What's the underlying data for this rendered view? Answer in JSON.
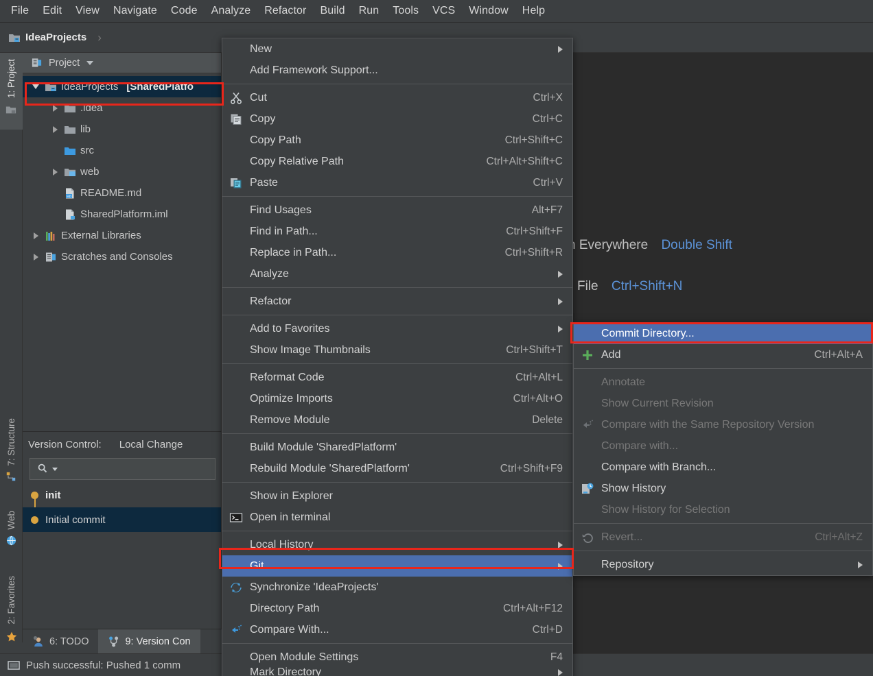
{
  "menubar": {
    "items": [
      {
        "label": "File",
        "mnemonic": "F"
      },
      {
        "label": "Edit",
        "mnemonic": "E"
      },
      {
        "label": "View",
        "mnemonic": "V"
      },
      {
        "label": "Navigate",
        "mnemonic": "N"
      },
      {
        "label": "Code",
        "mnemonic": "C"
      },
      {
        "label": "Analyze",
        "mnemonic": "y"
      },
      {
        "label": "Refactor",
        "mnemonic": "R"
      },
      {
        "label": "Build",
        "mnemonic": "B"
      },
      {
        "label": "Run",
        "mnemonic": "u"
      },
      {
        "label": "Tools",
        "mnemonic": "T"
      },
      {
        "label": "VCS",
        "mnemonic": "S"
      },
      {
        "label": "Window",
        "mnemonic": "W"
      },
      {
        "label": "Help",
        "mnemonic": "H"
      }
    ]
  },
  "navbar": {
    "project_name": "IdeaProjects",
    "separator": "›"
  },
  "toolstrip": {
    "left_top": [
      {
        "label": "1: Project",
        "icon": "project-icon",
        "active": true
      }
    ],
    "left_mid": [
      {
        "label": "7: Structure",
        "icon": "structure-icon"
      },
      {
        "label": "Web",
        "icon": "web-icon"
      }
    ],
    "left_bottom": [
      {
        "label": "2: Favorites",
        "icon": "favorites-star-icon"
      }
    ]
  },
  "project_panel": {
    "header": {
      "title": "Project",
      "icon": "project-view-icon",
      "chevron": "chevron-down-icon"
    },
    "tree": [
      {
        "label": "IdeaProjects",
        "suffix": "[SharedPlatfo",
        "depth": 0,
        "state": "expanded",
        "icon": "module-folder-icon",
        "selected": true,
        "highlighted": true
      },
      {
        "label": ".idea",
        "depth": 1,
        "state": "collapsed",
        "icon": "folder-icon"
      },
      {
        "label": "lib",
        "depth": 1,
        "state": "collapsed",
        "icon": "folder-icon"
      },
      {
        "label": "src",
        "depth": 1,
        "state": "leaf",
        "icon": "source-folder-icon"
      },
      {
        "label": "web",
        "depth": 1,
        "state": "collapsed",
        "icon": "web-folder-icon"
      },
      {
        "label": "README.md",
        "depth": 1,
        "state": "leaf",
        "icon": "markdown-file-icon"
      },
      {
        "label": "SharedPlatform.iml",
        "depth": 1,
        "state": "leaf",
        "icon": "iml-file-icon"
      },
      {
        "label": "External Libraries",
        "depth": 0,
        "state": "collapsed",
        "icon": "libraries-icon"
      },
      {
        "label": "Scratches and Consoles",
        "depth": 0,
        "state": "collapsed",
        "icon": "scratches-icon"
      }
    ]
  },
  "vcs_panel": {
    "title": "Version Control:",
    "tab": "Local Change",
    "search_icon": "search-icon",
    "search_value": "",
    "search_placeholder": "",
    "commits": [
      {
        "label": "init",
        "bold": true,
        "selected": false
      },
      {
        "label": "Initial commit",
        "bold": false,
        "selected": true
      }
    ]
  },
  "bottom_tabs": [
    {
      "label": "6: TODO",
      "number": "6",
      "icon": "todo-icon",
      "active": false
    },
    {
      "label": "9: Version Con",
      "number": "9",
      "icon": "version-control-icon",
      "active": true
    }
  ],
  "statusbar": {
    "icon": "ide-status-icon",
    "message": "Push successful: Pushed 1 comm"
  },
  "editor_hints": [
    {
      "label": "n Everywhere",
      "key": "Double Shift"
    },
    {
      "label": "File",
      "key": "Ctrl+Shift+N"
    }
  ],
  "context_menu": {
    "groups": [
      [
        {
          "label": "New",
          "mnemonic": "",
          "submenu": true
        },
        {
          "label": "Add Framework Support...",
          "mnemonic": ""
        }
      ],
      [
        {
          "label": "Cut",
          "mnemonic": "t",
          "accel": "Ctrl+X",
          "icon": "cut-icon"
        },
        {
          "label": "Copy",
          "mnemonic": "C",
          "accel": "Ctrl+C",
          "icon": "copy-icon"
        },
        {
          "label": "Copy Path",
          "mnemonic": "o",
          "accel": "Ctrl+Shift+C"
        },
        {
          "label": "Copy Relative Path",
          "mnemonic": "y",
          "accel": "Ctrl+Alt+Shift+C"
        },
        {
          "label": "Paste",
          "mnemonic": "P",
          "accel": "Ctrl+V",
          "icon": "paste-icon"
        }
      ],
      [
        {
          "label": "Find Usages",
          "mnemonic": "U",
          "accel": "Alt+F7"
        },
        {
          "label": "Find in Path...",
          "mnemonic": "P",
          "accel": "Ctrl+Shift+F"
        },
        {
          "label": "Replace in Path...",
          "mnemonic": "a",
          "accel": "Ctrl+Shift+R"
        },
        {
          "label": "Analyze",
          "mnemonic": "z",
          "submenu": true
        }
      ],
      [
        {
          "label": "Refactor",
          "mnemonic": "R",
          "submenu": true
        }
      ],
      [
        {
          "label": "Add to Favorites",
          "mnemonic": "a",
          "submenu": true
        },
        {
          "label": "Show Image Thumbnails",
          "mnemonic": "",
          "accel": "Ctrl+Shift+T"
        }
      ],
      [
        {
          "label": "Reformat Code",
          "mnemonic": "R",
          "accel": "Ctrl+Alt+L"
        },
        {
          "label": "Optimize Imports",
          "mnemonic": "z",
          "accel": "Ctrl+Alt+O"
        },
        {
          "label": "Remove Module",
          "mnemonic": "",
          "accel": "Delete"
        }
      ],
      [
        {
          "label": "Build Module 'SharedPlatform'",
          "mnemonic": "M"
        },
        {
          "label": "Rebuild Module 'SharedPlatform'",
          "mnemonic": "e",
          "accel": "Ctrl+Shift+F9"
        }
      ],
      [
        {
          "label": "Show in Explorer",
          "mnemonic": ""
        },
        {
          "label": "Open in terminal",
          "mnemonic": "",
          "icon": "terminal-icon"
        }
      ],
      [
        {
          "label": "Local History",
          "mnemonic": "H",
          "submenu": true
        },
        {
          "label": "Git",
          "mnemonic": "G",
          "submenu": true,
          "selected": true,
          "highlighted": true
        },
        {
          "label": "Synchronize 'IdeaProjects'",
          "mnemonic": "",
          "icon": "synchronize-icon"
        },
        {
          "label": "Directory Path",
          "mnemonic": "P",
          "accel": "Ctrl+Alt+F12"
        },
        {
          "label": "Compare With...",
          "mnemonic": "",
          "accel": "Ctrl+D",
          "icon": "compare-icon"
        }
      ],
      [
        {
          "label": "Open Module Settings",
          "mnemonic": "",
          "accel": "F4"
        },
        {
          "label": "Mark Directory",
          "mnemonic": "",
          "submenu": true,
          "clipped": true
        }
      ]
    ]
  },
  "git_submenu": {
    "groups": [
      [
        {
          "label": "Commit Directory...",
          "mnemonic": "i",
          "selected": true,
          "highlighted": true
        },
        {
          "label": "Add",
          "mnemonic": "",
          "accel": "Ctrl+Alt+A",
          "icon": "add-plus-icon"
        }
      ],
      [
        {
          "label": "Annotate",
          "mnemonic": "n",
          "disabled": true
        },
        {
          "label": "Show Current Revision",
          "mnemonic": "",
          "disabled": true
        },
        {
          "label": "Compare with the Same Repository Version",
          "mnemonic": "y",
          "disabled": true,
          "icon": "compare-dim-icon"
        },
        {
          "label": "Compare with...",
          "mnemonic": "C",
          "disabled": true
        },
        {
          "label": "Compare with Branch...",
          "mnemonic": ""
        },
        {
          "label": "Show History",
          "mnemonic": "H",
          "icon": "show-history-icon"
        },
        {
          "label": "Show History for Selection",
          "mnemonic": "f",
          "disabled": true
        }
      ],
      [
        {
          "label": "Revert...",
          "mnemonic": "R",
          "accel": "Ctrl+Alt+Z",
          "disabled": true,
          "icon": "revert-icon"
        }
      ],
      [
        {
          "label": "Repository",
          "mnemonic": "R",
          "submenu": true
        }
      ]
    ]
  },
  "colors": {
    "bg_panel": "#3c3f41",
    "bg_editor": "#2b2b2b",
    "selection_blue": "#4b6eaf",
    "tree_selection": "#0d293e",
    "annotation_red": "#e8261b",
    "hint_key_blue": "#5c93d8",
    "commit_dot_orange": "#d9a441"
  }
}
